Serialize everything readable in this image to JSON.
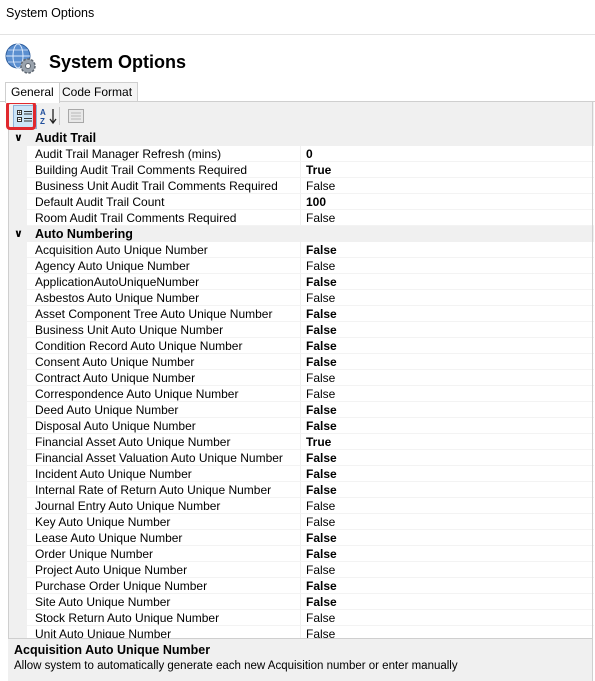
{
  "window": {
    "title": "System Options"
  },
  "header": {
    "title": "System Options",
    "icon": "gear-globe-icon"
  },
  "tabs": [
    {
      "label": "General",
      "active": true
    },
    {
      "label": "Code Format",
      "active": false
    }
  ],
  "toolbar": {
    "buttons": [
      {
        "icon": "categorized-icon",
        "pressed": true
      },
      {
        "icon": "sort-az-icon",
        "pressed": false
      },
      {
        "icon": "property-pages-icon",
        "pressed": false
      }
    ],
    "highlight_color": "#e0282e"
  },
  "categories": [
    {
      "name": "Audit Trail",
      "properties": [
        {
          "name": "Audit Trail Manager Refresh (mins)",
          "value": "0",
          "bold": true
        },
        {
          "name": "Building Audit Trail Comments Required",
          "value": "True",
          "bold": true
        },
        {
          "name": "Business Unit Audit Trail Comments Required",
          "value": "False",
          "bold": false
        },
        {
          "name": "Default Audit Trail Count",
          "value": "100",
          "bold": true
        },
        {
          "name": "Room Audit Trail Comments Required",
          "value": "False",
          "bold": false
        }
      ]
    },
    {
      "name": "Auto Numbering",
      "properties": [
        {
          "name": "Acquisition Auto Unique Number",
          "value": "False",
          "bold": true
        },
        {
          "name": "Agency Auto Unique Number",
          "value": "False",
          "bold": false
        },
        {
          "name": "ApplicationAutoUniqueNumber",
          "value": "False",
          "bold": true
        },
        {
          "name": "Asbestos Auto Unique Number",
          "value": "False",
          "bold": false
        },
        {
          "name": "Asset Component Tree Auto Unique Number",
          "value": "False",
          "bold": true
        },
        {
          "name": "Business Unit Auto Unique Number",
          "value": "False",
          "bold": true
        },
        {
          "name": "Condition Record Auto Unique Number",
          "value": "False",
          "bold": true
        },
        {
          "name": "Consent Auto Unique Number",
          "value": "False",
          "bold": true
        },
        {
          "name": "Contract Auto Unique Number",
          "value": "False",
          "bold": false
        },
        {
          "name": "Correspondence Auto Unique Number",
          "value": "False",
          "bold": false
        },
        {
          "name": "Deed Auto Unique Number",
          "value": "False",
          "bold": true
        },
        {
          "name": "Disposal Auto Unique Number",
          "value": "False",
          "bold": true
        },
        {
          "name": "Financial Asset Auto Unique Number",
          "value": "True",
          "bold": true
        },
        {
          "name": "Financial Asset Valuation Auto Unique Number",
          "value": "False",
          "bold": true
        },
        {
          "name": "Incident Auto Unique Number",
          "value": "False",
          "bold": true
        },
        {
          "name": "Internal Rate of Return Auto Unique Number",
          "value": "False",
          "bold": true
        },
        {
          "name": "Journal Entry Auto Unique Number",
          "value": "False",
          "bold": false
        },
        {
          "name": "Key Auto Unique Number",
          "value": "False",
          "bold": false
        },
        {
          "name": "Lease Auto Unique Number",
          "value": "False",
          "bold": true
        },
        {
          "name": "Order Unique Number",
          "value": "False",
          "bold": true
        },
        {
          "name": "Project Auto Unique Number",
          "value": "False",
          "bold": false
        },
        {
          "name": "Purchase Order Unique Number",
          "value": "False",
          "bold": true
        },
        {
          "name": "Site Auto Unique Number",
          "value": "False",
          "bold": true
        },
        {
          "name": "Stock Return Auto Unique Number",
          "value": "False",
          "bold": false
        },
        {
          "name": "Unit Auto Unique Number",
          "value": "False",
          "bold": false
        }
      ]
    }
  ],
  "description": {
    "title": "Acquisition Auto Unique Number",
    "text": "Allow system to automatically generate each new Acquisition number or enter manually"
  }
}
